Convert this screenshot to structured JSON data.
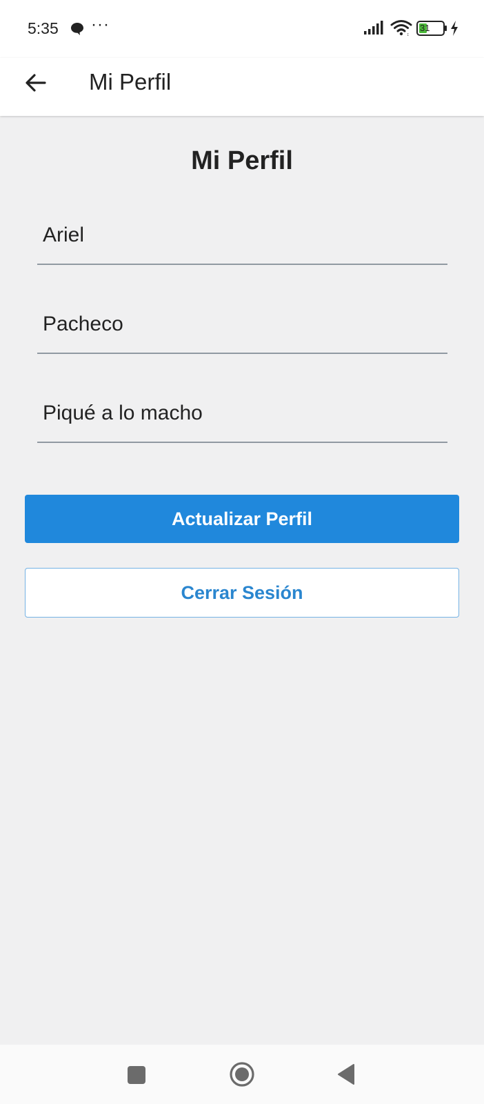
{
  "status_bar": {
    "time": "5:35",
    "dots": "···",
    "battery": "31",
    "icons": [
      "chat-bubble-icon",
      "signal-icon",
      "wifi-icon",
      "battery-icon",
      "charging-bolt-icon"
    ]
  },
  "app_bar": {
    "title": "Mi Perfil",
    "back_icon": "arrow-left-icon"
  },
  "main": {
    "title": "Mi Perfil",
    "fields": [
      {
        "value": "Ariel"
      },
      {
        "value": "Pacheco"
      },
      {
        "value": "Piqué a lo macho"
      }
    ],
    "update_button": "Actualizar Perfil",
    "logout_button": "Cerrar Sesión"
  },
  "nav_bar": {
    "icons": [
      "recents-square-icon",
      "home-circle-icon",
      "back-triangle-icon"
    ]
  },
  "colors": {
    "primary": "#2088dc",
    "background": "#f0f0f1",
    "outline_text": "#2a86cf"
  }
}
